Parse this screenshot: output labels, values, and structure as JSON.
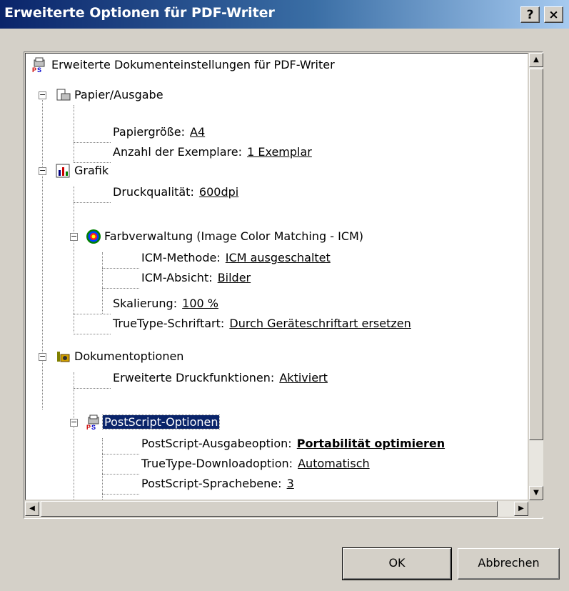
{
  "window": {
    "title": "Erweiterte Optionen für PDF-Writer",
    "help_label": "?",
    "close_label": "×"
  },
  "tree": {
    "root": "Erweiterte Dokumenteinstellungen für PDF-Writer",
    "paper": {
      "label": "Papier/Ausgabe",
      "size_label": "Papiergröße:",
      "size_value": "A4",
      "copies_label": "Anzahl der Exemplare:",
      "copies_value": "1 Exemplar"
    },
    "graphics": {
      "label": "Grafik",
      "quality_label": "Druckqualität:",
      "quality_value": "600dpi",
      "color_label": "Farbverwaltung (Image Color Matching - ICM)",
      "icm_method_label": "ICM-Methode:",
      "icm_method_value": "ICM ausgeschaltet",
      "icm_intent_label": "ICM-Absicht:",
      "icm_intent_value": "Bilder",
      "scaling_label": "Skalierung:",
      "scaling_value": "100 %",
      "truetype_label": "TrueType-Schriftart:",
      "truetype_value": "Durch Geräteschriftart ersetzen"
    },
    "docopts": {
      "label": "Dokumentoptionen",
      "advanced_label": "Erweiterte Druckfunktionen:",
      "advanced_value": "Aktiviert",
      "ps_label": "PostScript-Optionen",
      "ps_output_label": "PostScript-Ausgabeoption:",
      "ps_output_value": "Portabilität optimieren",
      "tt_download_label": "TrueType-Downloadoption:",
      "tt_download_value": "Automatisch",
      "ps_level_label": "PostScript-Sprachebene:",
      "ps_level_value": "3"
    }
  },
  "buttons": {
    "ok": "OK",
    "cancel": "Abbrechen"
  },
  "colors": {
    "titlebar": "#0a246a",
    "selection": "#0a246a",
    "face": "#d4d0c8"
  }
}
